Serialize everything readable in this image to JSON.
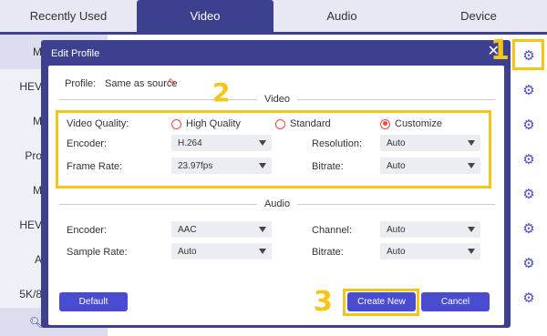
{
  "tabs": [
    "Recently Used",
    "Video",
    "Audio",
    "Device"
  ],
  "left_list": [
    "M",
    "HEV",
    "M",
    "Pro",
    "M",
    "HEV",
    "A",
    "5K/8"
  ],
  "gear_icon": "gear-icon",
  "annotations": {
    "n1": "1",
    "n2": "2",
    "n3": "3"
  },
  "dialog": {
    "title": "Edit Profile",
    "close": "✕",
    "profile_label": "Profile:",
    "profile_value": "Same as source",
    "video_section": "Video",
    "video_quality_label": "Video Quality:",
    "quality_options": [
      "High Quality",
      "Standard",
      "Customize"
    ],
    "quality_selected": "Customize",
    "encoder_label": "Encoder:",
    "encoder_value": "H.264",
    "resolution_label": "Resolution:",
    "resolution_value": "Auto",
    "frame_rate_label": "Frame Rate:",
    "frame_rate_value": "23.97fps",
    "bitrate_label": "Bitrate:",
    "bitrate_value": "Auto",
    "audio_section": "Audio",
    "audio_encoder_label": "Encoder:",
    "audio_encoder_value": "AAC",
    "channel_label": "Channel:",
    "channel_value": "Auto",
    "sample_rate_label": "Sample Rate:",
    "sample_rate_value": "Auto",
    "audio_bitrate_label": "Bitrate:",
    "audio_bitrate_value": "Auto",
    "default_button": "Default",
    "create_button": "Create New",
    "cancel_button": "Cancel"
  },
  "colors": {
    "accent": "#3d3f8f",
    "button": "#4a4ccf",
    "highlight": "#f5c518",
    "radio": "#e74c3c"
  }
}
